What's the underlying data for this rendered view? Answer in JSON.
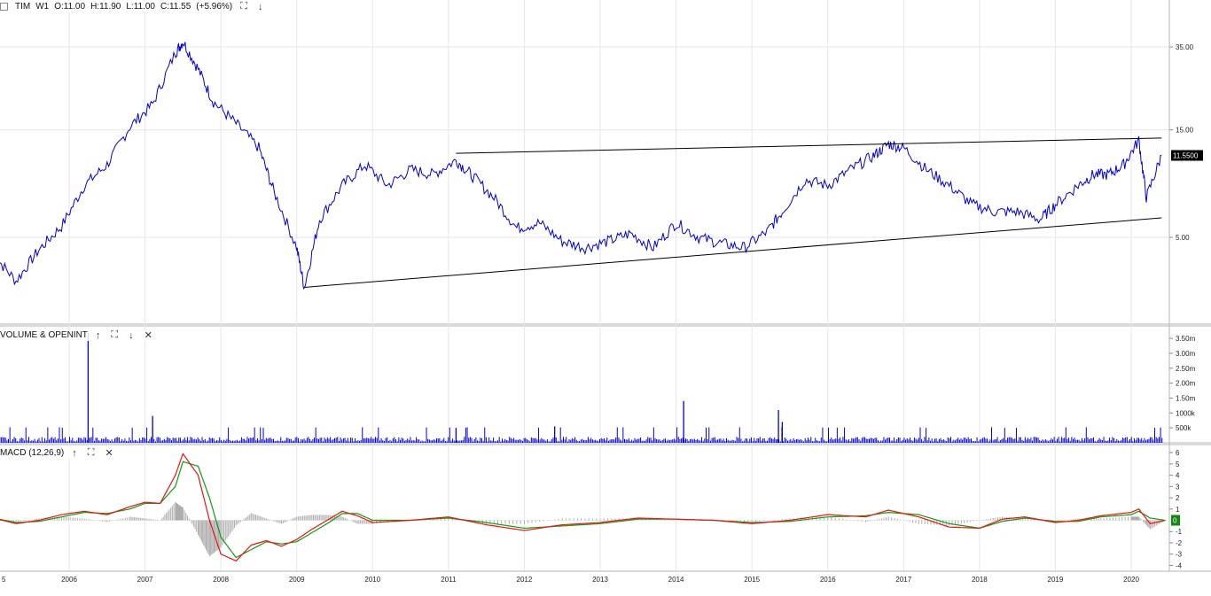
{
  "header": {
    "symbol": "TIM",
    "interval": "W1",
    "open": "O:11.00",
    "high": "H:11.90",
    "low": "L:11.00",
    "close": "C:11.55",
    "change": "(+5.96%)"
  },
  "panels": {
    "volume_title": "VOLUME & OPENINT",
    "macd_title": "MACD (12,26,9)"
  },
  "icons": {
    "up": "↑",
    "down": "↓",
    "expand": "⛶",
    "close": "✕"
  },
  "colors": {
    "price_line": "#0000dd",
    "volume_bar": "#0000dd",
    "macd_line": "#ee1111",
    "signal_line": "#119911",
    "histogram": "#aaaaaa",
    "trendline": "#000000",
    "grid": "#e6e6e6",
    "last_price_bg": "#000000",
    "macd_last_bg": "#118811"
  },
  "chart_data": [
    {
      "type": "line",
      "panel": "price",
      "ylim": [
        1.5,
        75
      ],
      "log_scale": true,
      "y_ticks": [
        {
          "value": 35,
          "label": "35.00"
        },
        {
          "value": 15,
          "label": "15.00"
        },
        {
          "value": 5,
          "label": "5.00"
        }
      ],
      "x_ticks": [
        "5",
        "2006",
        "2007",
        "2008",
        "2009",
        "2010",
        "2011",
        "2012",
        "2013",
        "2014",
        "2015",
        "2016",
        "2017",
        "2018",
        "2019",
        "2020"
      ],
      "x": [
        2005.0,
        2005.3,
        2005.6,
        2005.9,
        2006.2,
        2006.5,
        2006.8,
        2007.1,
        2007.4,
        2007.5,
        2007.7,
        2007.9,
        2008.2,
        2008.5,
        2008.7,
        2009.0,
        2009.1,
        2009.3,
        2009.6,
        2009.9,
        2010.2,
        2010.5,
        2010.8,
        2011.1,
        2011.3,
        2011.6,
        2011.9,
        2012.2,
        2012.5,
        2012.8,
        2013.1,
        2013.4,
        2013.7,
        2014.0,
        2014.3,
        2014.6,
        2014.9,
        2015.2,
        2015.4,
        2015.7,
        2016.0,
        2016.3,
        2016.6,
        2016.8,
        2017.0,
        2017.3,
        2017.6,
        2017.9,
        2018.2,
        2018.5,
        2018.8,
        2019.0,
        2019.3,
        2019.5,
        2019.7,
        2019.9,
        2020.1,
        2020.2,
        2020.4
      ],
      "series": [
        {
          "values": [
            4.2,
            3.2,
            4.4,
            5.6,
            8.5,
            10.5,
            15.5,
            19.5,
            33.0,
            37.0,
            28.0,
            20.0,
            16.0,
            12.5,
            8.0,
            4.5,
            3.0,
            6.0,
            8.5,
            10.5,
            8.5,
            10.0,
            9.5,
            11.0,
            9.5,
            7.5,
            5.5,
            5.8,
            4.8,
            4.5,
            4.8,
            5.2,
            4.5,
            5.8,
            5.0,
            4.7,
            4.5,
            5.3,
            6.5,
            9.0,
            8.5,
            10.0,
            11.5,
            13.0,
            12.5,
            10.0,
            8.5,
            7.0,
            6.5,
            6.5,
            6.0,
            7.0,
            8.5,
            9.5,
            9.5,
            10.5,
            13.5,
            7.5,
            11.55
          ]
        }
      ],
      "trendlines": [
        {
          "x": [
            2009.1,
            2020.4
          ],
          "y": [
            3.0,
            6.1
          ]
        },
        {
          "x": [
            2011.1,
            2020.4
          ],
          "y": [
            11.8,
            13.8
          ]
        }
      ],
      "last_value_label": "11.5500"
    },
    {
      "type": "bar",
      "panel": "volume",
      "ylim": [
        0,
        3800000
      ],
      "y_ticks": [
        {
          "value": 3500000,
          "label": "3.50m"
        },
        {
          "value": 3000000,
          "label": "3.00m"
        },
        {
          "value": 2500000,
          "label": "2.50m"
        },
        {
          "value": 2000000,
          "label": "2.00m"
        },
        {
          "value": 1500000,
          "label": "1.50m"
        },
        {
          "value": 1000000,
          "label": "1000k"
        },
        {
          "value": 500000,
          "label": "500k"
        }
      ],
      "spikes": [
        {
          "x": 2006.25,
          "value": 3700000
        },
        {
          "x": 2007.1,
          "value": 900000
        },
        {
          "x": 2014.1,
          "value": 1400000
        },
        {
          "x": 2015.35,
          "value": 1100000
        },
        {
          "x": 2015.4,
          "value": 700000
        },
        {
          "x": 2011.1,
          "value": 500000
        },
        {
          "x": 2012.4,
          "value": 550000
        }
      ],
      "typical_value": 150000
    },
    {
      "type": "line",
      "panel": "macd",
      "ylim": [
        -4.2,
        6.4
      ],
      "y_ticks": [
        {
          "value": 6,
          "label": "6"
        },
        {
          "value": 5,
          "label": "5"
        },
        {
          "value": 4,
          "label": "4"
        },
        {
          "value": 3,
          "label": "3"
        },
        {
          "value": 2,
          "label": "2"
        },
        {
          "value": 1,
          "label": "1"
        },
        {
          "value": -1,
          "label": "-1"
        },
        {
          "value": -2,
          "label": "-2"
        },
        {
          "value": -3,
          "label": "-3"
        },
        {
          "value": -4,
          "label": "-4"
        }
      ],
      "x": [
        2005.0,
        2005.3,
        2005.6,
        2005.9,
        2006.2,
        2006.5,
        2006.8,
        2007.0,
        2007.2,
        2007.4,
        2007.5,
        2007.7,
        2007.85,
        2008.0,
        2008.2,
        2008.4,
        2008.6,
        2008.8,
        2009.0,
        2009.2,
        2009.4,
        2009.6,
        2009.8,
        2010.0,
        2010.5,
        2011.0,
        2011.5,
        2012.0,
        2012.5,
        2013.0,
        2013.5,
        2014.0,
        2014.5,
        2015.0,
        2015.5,
        2016.0,
        2016.5,
        2016.8,
        2017.2,
        2017.6,
        2018.0,
        2018.3,
        2018.6,
        2019.0,
        2019.3,
        2019.6,
        2020.0,
        2020.1,
        2020.25,
        2020.45
      ],
      "series": [
        {
          "name": "MACD",
          "values": [
            0.2,
            -0.3,
            0.0,
            0.5,
            0.8,
            0.5,
            1.2,
            1.6,
            1.5,
            4.0,
            5.9,
            4.0,
            0.0,
            -3.0,
            -3.6,
            -2.2,
            -1.8,
            -2.3,
            -1.7,
            -0.8,
            0.0,
            0.8,
            0.4,
            -0.2,
            0.0,
            0.3,
            -0.4,
            -0.9,
            -0.4,
            -0.2,
            0.2,
            0.1,
            0.0,
            -0.3,
            0.0,
            0.5,
            0.3,
            0.9,
            0.3,
            -0.6,
            -0.7,
            0.1,
            0.3,
            -0.2,
            0.0,
            0.4,
            0.7,
            1.0,
            -0.3,
            0.0
          ]
        },
        {
          "name": "Signal",
          "values": [
            0.2,
            -0.2,
            -0.1,
            0.3,
            0.7,
            0.6,
            1.0,
            1.5,
            1.5,
            3.0,
            5.2,
            4.8,
            2.0,
            -1.5,
            -3.3,
            -2.6,
            -1.9,
            -2.1,
            -1.9,
            -1.1,
            -0.3,
            0.6,
            0.6,
            0.0,
            0.0,
            0.2,
            -0.2,
            -0.7,
            -0.5,
            -0.3,
            0.1,
            0.1,
            0.0,
            -0.2,
            -0.1,
            0.3,
            0.4,
            0.7,
            0.5,
            -0.3,
            -0.7,
            -0.1,
            0.2,
            -0.1,
            -0.1,
            0.3,
            0.5,
            0.8,
            0.2,
            0.0
          ]
        }
      ],
      "last_value_label": "0"
    }
  ]
}
